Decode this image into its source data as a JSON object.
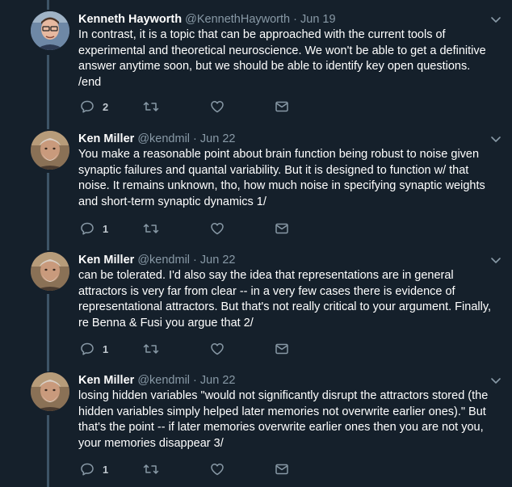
{
  "tweets": [
    {
      "name": "Kenneth Hayworth",
      "handle": "@KennethHayworth",
      "separator": "·",
      "date": "Jun 19",
      "lines": [
        "In contrast, it is a topic that can be approached with the current tools of",
        "experimental and theoretical neuroscience. We won't be able to get a definitive",
        "answer anytime soon, but we should be able to identify key open questions.",
        "/end"
      ],
      "reply_count": "2",
      "avatar": "avatar-kenneth-hayworth"
    },
    {
      "name": "Ken Miller",
      "handle": "@kendmil",
      "separator": "·",
      "date": "Jun 22",
      "lines": [
        "You make a reasonable point about brain function being robust to noise given",
        "synaptic failures and quantal variability. But it is designed to function w/ that",
        "noise. It remains unknown, tho, how much noise in specifying synaptic weights",
        "and short-term synaptic dynamics 1/"
      ],
      "reply_count": "1",
      "avatar": "avatar-ken-miller"
    },
    {
      "name": "Ken Miller",
      "handle": "@kendmil",
      "separator": "·",
      "date": "Jun 22",
      "lines": [
        "can be tolerated. I'd also say the idea that representations are in general",
        "attractors is very far from clear -- in a very few cases there is evidence of",
        "representational attractors. But that's not really critical to your argument. Finally,",
        "re Benna & Fusi you argue that 2/"
      ],
      "reply_count": "1",
      "avatar": "avatar-ken-miller"
    },
    {
      "name": "Ken Miller",
      "handle": "@kendmil",
      "separator": "·",
      "date": "Jun 22",
      "lines": [
        "losing hidden variables \"would not significantly disrupt the attractors stored (the",
        "hidden variables simply helped later memories not overwrite earlier ones).\" But",
        "that's the point -- if later memories overwrite earlier ones then you are not you,",
        "your memories disappear 3/"
      ],
      "reply_count": "1",
      "avatar": "avatar-ken-miller"
    }
  ],
  "icons": [
    "chevron-down-icon",
    "reply-icon",
    "retweet-icon",
    "like-icon",
    "dm-icon"
  ],
  "colors": {
    "background": "#15202b",
    "secondary_text": "#8899a6",
    "thread_line": "#3d5466"
  }
}
